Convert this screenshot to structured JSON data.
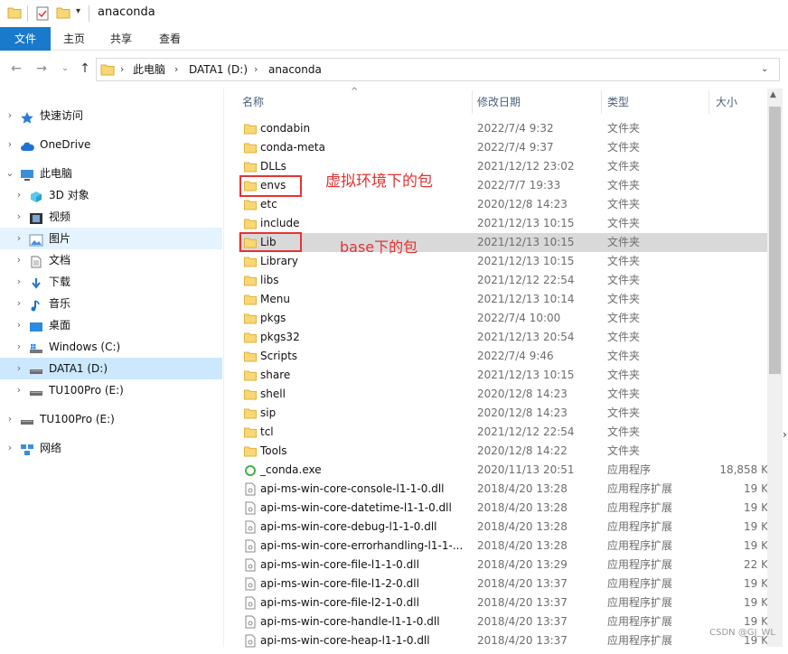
{
  "title_bar": {
    "title": "anaconda"
  },
  "ribbon": {
    "tabs": [
      "文件",
      "主页",
      "共享",
      "查看"
    ]
  },
  "address": {
    "crumbs": [
      "此电脑",
      "DATA1 (D:)",
      "anaconda"
    ]
  },
  "nav_pane": {
    "items": [
      {
        "label": "快速访问",
        "icon": "star-icon",
        "level": 0
      },
      {
        "label": "OneDrive",
        "icon": "cloud-icon",
        "level": 0
      },
      {
        "label": "此电脑",
        "icon": "computer-icon",
        "level": 0,
        "expanded": true
      },
      {
        "label": "3D 对象",
        "icon": "cube-icon",
        "level": 1
      },
      {
        "label": "视频",
        "icon": "video-icon",
        "level": 1
      },
      {
        "label": "图片",
        "icon": "picture-icon",
        "level": 1,
        "state": "hover"
      },
      {
        "label": "文档",
        "icon": "document-icon",
        "level": 1
      },
      {
        "label": "下载",
        "icon": "download-icon",
        "level": 1
      },
      {
        "label": "音乐",
        "icon": "music-icon",
        "level": 1
      },
      {
        "label": "桌面",
        "icon": "desktop-icon",
        "level": 1
      },
      {
        "label": "Windows (C:)",
        "icon": "windows-drive-icon",
        "level": 1
      },
      {
        "label": "DATA1 (D:)",
        "icon": "drive-icon",
        "level": 1,
        "state": "selected"
      },
      {
        "label": "TU100Pro (E:)",
        "icon": "drive-icon",
        "level": 1
      },
      {
        "label": "TU100Pro (E:)",
        "icon": "drive-icon",
        "level": 0
      },
      {
        "label": "网络",
        "icon": "network-icon",
        "level": 0
      }
    ]
  },
  "columns": {
    "name": "名称",
    "date": "修改日期",
    "type": "类型",
    "size": "大小"
  },
  "files": [
    {
      "name": "condabin",
      "date": "2022/7/4 9:32",
      "type": "文件夹",
      "size": "",
      "icon": "folder-icon"
    },
    {
      "name": "conda-meta",
      "date": "2022/7/4 9:37",
      "type": "文件夹",
      "size": "",
      "icon": "folder-icon"
    },
    {
      "name": "DLLs",
      "date": "2021/12/12 23:02",
      "type": "文件夹",
      "size": "",
      "icon": "folder-icon"
    },
    {
      "name": "envs",
      "date": "2022/7/7 19:33",
      "type": "文件夹",
      "size": "",
      "icon": "folder-icon"
    },
    {
      "name": "etc",
      "date": "2020/12/8 14:23",
      "type": "文件夹",
      "size": "",
      "icon": "folder-icon"
    },
    {
      "name": "include",
      "date": "2021/12/13 10:15",
      "type": "文件夹",
      "size": "",
      "icon": "folder-icon"
    },
    {
      "name": "Lib",
      "date": "2021/12/13 10:15",
      "type": "文件夹",
      "size": "",
      "icon": "folder-icon",
      "selected": true
    },
    {
      "name": "Library",
      "date": "2021/12/13 10:15",
      "type": "文件夹",
      "size": "",
      "icon": "folder-icon"
    },
    {
      "name": "libs",
      "date": "2021/12/12 22:54",
      "type": "文件夹",
      "size": "",
      "icon": "folder-icon"
    },
    {
      "name": "Menu",
      "date": "2021/12/13 10:14",
      "type": "文件夹",
      "size": "",
      "icon": "folder-icon"
    },
    {
      "name": "pkgs",
      "date": "2022/7/4 10:00",
      "type": "文件夹",
      "size": "",
      "icon": "folder-icon"
    },
    {
      "name": "pkgs32",
      "date": "2021/12/13 20:54",
      "type": "文件夹",
      "size": "",
      "icon": "folder-icon"
    },
    {
      "name": "Scripts",
      "date": "2022/7/4 9:46",
      "type": "文件夹",
      "size": "",
      "icon": "folder-icon"
    },
    {
      "name": "share",
      "date": "2021/12/13 10:15",
      "type": "文件夹",
      "size": "",
      "icon": "folder-icon"
    },
    {
      "name": "shell",
      "date": "2020/12/8 14:23",
      "type": "文件夹",
      "size": "",
      "icon": "folder-icon"
    },
    {
      "name": "sip",
      "date": "2020/12/8 14:23",
      "type": "文件夹",
      "size": "",
      "icon": "folder-icon"
    },
    {
      "name": "tcl",
      "date": "2021/12/12 22:54",
      "type": "文件夹",
      "size": "",
      "icon": "folder-icon"
    },
    {
      "name": "Tools",
      "date": "2020/12/8 14:22",
      "type": "文件夹",
      "size": "",
      "icon": "folder-icon"
    },
    {
      "name": "_conda.exe",
      "date": "2020/11/13 20:51",
      "type": "应用程序",
      "size": "18,858 K",
      "icon": "exe-icon"
    },
    {
      "name": "api-ms-win-core-console-l1-1-0.dll",
      "date": "2018/4/20 13:28",
      "type": "应用程序扩展",
      "size": "19 K",
      "icon": "dll-icon"
    },
    {
      "name": "api-ms-win-core-datetime-l1-1-0.dll",
      "date": "2018/4/20 13:28",
      "type": "应用程序扩展",
      "size": "19 K",
      "icon": "dll-icon"
    },
    {
      "name": "api-ms-win-core-debug-l1-1-0.dll",
      "date": "2018/4/20 13:28",
      "type": "应用程序扩展",
      "size": "19 K",
      "icon": "dll-icon"
    },
    {
      "name": "api-ms-win-core-errorhandling-l1-1-...",
      "date": "2018/4/20 13:28",
      "type": "应用程序扩展",
      "size": "19 K",
      "icon": "dll-icon"
    },
    {
      "name": "api-ms-win-core-file-l1-1-0.dll",
      "date": "2018/4/20 13:29",
      "type": "应用程序扩展",
      "size": "22 K",
      "icon": "dll-icon"
    },
    {
      "name": "api-ms-win-core-file-l1-2-0.dll",
      "date": "2018/4/20 13:37",
      "type": "应用程序扩展",
      "size": "19 K",
      "icon": "dll-icon"
    },
    {
      "name": "api-ms-win-core-file-l2-1-0.dll",
      "date": "2018/4/20 13:37",
      "type": "应用程序扩展",
      "size": "19 K",
      "icon": "dll-icon"
    },
    {
      "name": "api-ms-win-core-handle-l1-1-0.dll",
      "date": "2018/4/20 13:37",
      "type": "应用程序扩展",
      "size": "19 K",
      "icon": "dll-icon"
    },
    {
      "name": "api-ms-win-core-heap-l1-1-0.dll",
      "date": "2018/4/20 13:37",
      "type": "应用程序扩展",
      "size": "19 K",
      "icon": "dll-icon"
    }
  ],
  "annotations": {
    "envs_note": "虚拟环境下的包",
    "lib_note": "base下的包"
  },
  "watermark": "CSDN @GJ_WL",
  "colors": {
    "accent": "#1979ca",
    "annotation": "#e53333",
    "selected_row": "#d9d9d9",
    "selected_nav": "#cce8ff"
  }
}
